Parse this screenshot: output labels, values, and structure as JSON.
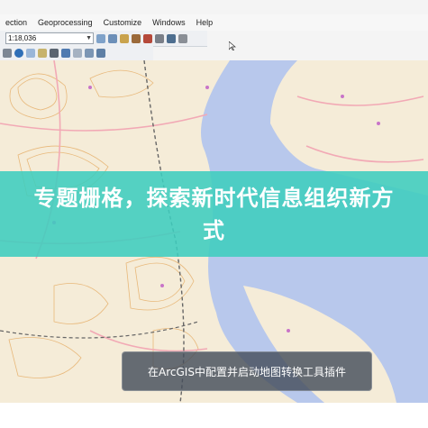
{
  "menubar": {
    "items": [
      {
        "label": "ection"
      },
      {
        "label": "Geoprocessing"
      },
      {
        "label": "Customize"
      },
      {
        "label": "Windows"
      },
      {
        "label": "Help"
      }
    ]
  },
  "toolbar": {
    "scale_value": "1:18,036",
    "icons": [
      "add-data-icon",
      "layer-icon",
      "table-icon",
      "catalog-icon",
      "search-window-icon",
      "model-icon",
      "toolbox-icon",
      "editor-icon"
    ]
  },
  "toolbar2": {
    "icons": [
      "arrow-icon",
      "info-icon",
      "clear-selection-icon",
      "measure-icon",
      "find-icon",
      "go-to-xy-icon",
      "time-slider-icon",
      "report-icon",
      "identify-icon"
    ]
  },
  "banner": {
    "title": "专题栅格，探索新时代信息组织新方式"
  },
  "caption": {
    "text": "在ArcGIS中配置并启动地图转换工具插件"
  },
  "colors": {
    "land": "#f5ecd8",
    "water": "#b8c8ec",
    "contour": "#e8b87a",
    "road": "#f2a9b5",
    "banner": "#3ecdbe"
  }
}
